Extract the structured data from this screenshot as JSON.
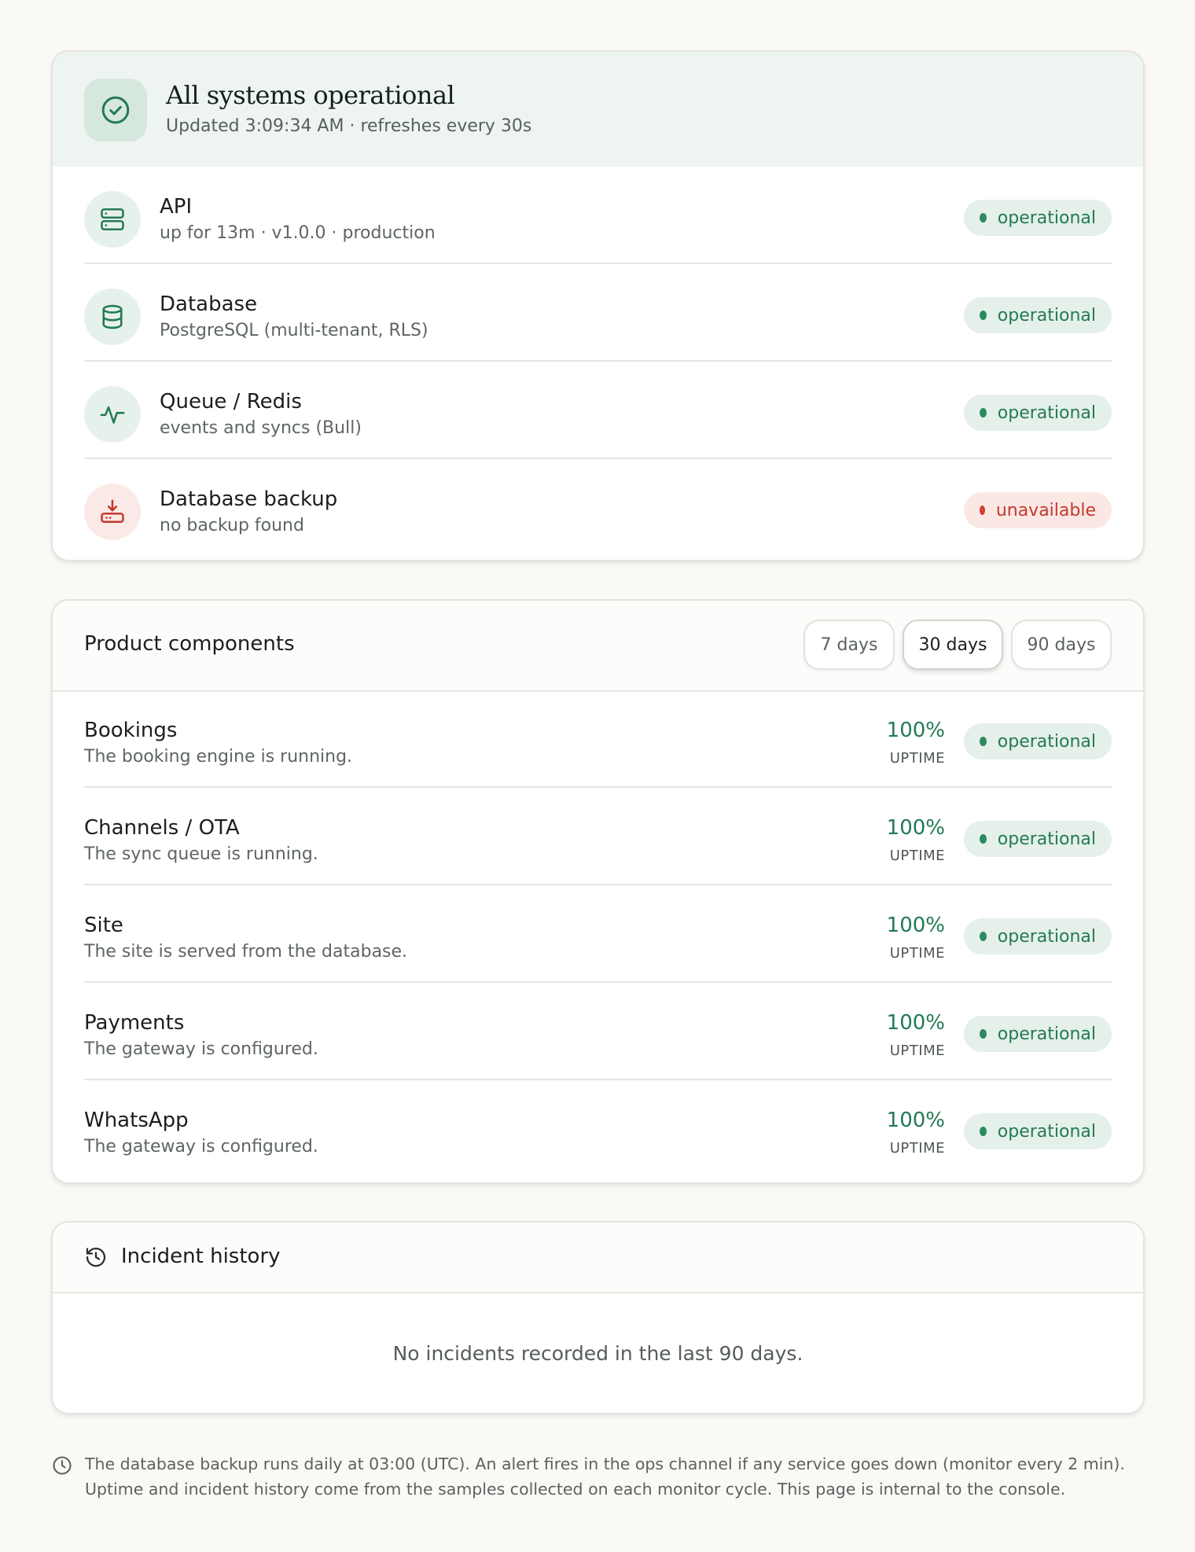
{
  "summary": {
    "title": "All systems operational",
    "subtitle": "Updated 3:09:34 AM · refreshes every 30s",
    "icon": "check-circle-icon"
  },
  "services": [
    {
      "name": "API",
      "desc": "up for 13m · v1.0.0 · production",
      "status": "operational",
      "icon": "server-icon"
    },
    {
      "name": "Database",
      "desc": "PostgreSQL (multi-tenant, RLS)",
      "status": "operational",
      "icon": "database-icon"
    },
    {
      "name": "Queue / Redis",
      "desc": "events and syncs (Bull)",
      "status": "operational",
      "icon": "activity-icon"
    },
    {
      "name": "Database backup",
      "desc": "no backup found",
      "status": "unavailable",
      "icon": "hard-drive-download-icon"
    }
  ],
  "components": {
    "title": "Product components",
    "ranges": [
      "7 days",
      "30 days",
      "90 days"
    ],
    "selected_range": "30 days",
    "uptime_label": "UPTIME",
    "items": [
      {
        "name": "Bookings",
        "desc": "The booking engine is running.",
        "uptime": "100%",
        "status": "operational"
      },
      {
        "name": "Channels / OTA",
        "desc": "The sync queue is running.",
        "uptime": "100%",
        "status": "operational"
      },
      {
        "name": "Site",
        "desc": "The site is served from the database.",
        "uptime": "100%",
        "status": "operational"
      },
      {
        "name": "Payments",
        "desc": "The gateway is configured.",
        "uptime": "100%",
        "status": "operational"
      },
      {
        "name": "WhatsApp",
        "desc": "The gateway is configured.",
        "uptime": "100%",
        "status": "operational"
      }
    ]
  },
  "incidents": {
    "title": "Incident history",
    "empty": "No incidents recorded in the last 90 days."
  },
  "footer": {
    "text": "The database backup runs daily at 03:00 (UTC). An alert fires in the ops channel if any service goes down (monitor every 2 min). Uptime and incident history come from the samples collected on each monitor cycle. This page is internal to the console."
  },
  "colors": {
    "ok": "#237a55",
    "ok_bg": "#e5f0ea",
    "bad": "#c23a2e",
    "bad_bg": "#fbe7e4",
    "page_bg": "#faf9f6"
  }
}
